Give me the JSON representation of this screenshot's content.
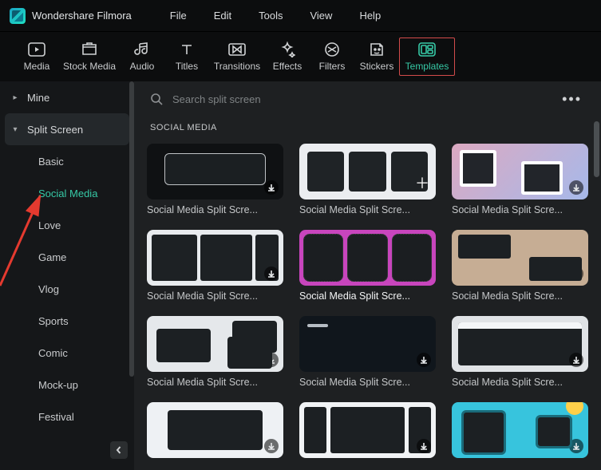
{
  "app": {
    "name": "Wondershare Filmora"
  },
  "menu": {
    "items": [
      "File",
      "Edit",
      "Tools",
      "View",
      "Help"
    ]
  },
  "toolbar": {
    "items": [
      {
        "id": "media",
        "label": "Media"
      },
      {
        "id": "stock",
        "label": "Stock Media"
      },
      {
        "id": "audio",
        "label": "Audio"
      },
      {
        "id": "titles",
        "label": "Titles"
      },
      {
        "id": "transitions",
        "label": "Transitions"
      },
      {
        "id": "effects",
        "label": "Effects"
      },
      {
        "id": "filters",
        "label": "Filters"
      },
      {
        "id": "stickers",
        "label": "Stickers"
      },
      {
        "id": "templates",
        "label": "Templates"
      }
    ],
    "active": "templates"
  },
  "sidebar": {
    "categories": [
      {
        "id": "mine",
        "label": "Mine",
        "expanded": false
      },
      {
        "id": "split",
        "label": "Split Screen",
        "expanded": true,
        "selected": true
      }
    ],
    "subcategories": [
      {
        "id": "basic",
        "label": "Basic"
      },
      {
        "id": "social",
        "label": "Social Media",
        "active": true
      },
      {
        "id": "love",
        "label": "Love"
      },
      {
        "id": "game",
        "label": "Game"
      },
      {
        "id": "vlog",
        "label": "Vlog"
      },
      {
        "id": "sports",
        "label": "Sports"
      },
      {
        "id": "comic",
        "label": "Comic"
      },
      {
        "id": "mockup",
        "label": "Mock-up"
      },
      {
        "id": "festival",
        "label": "Festival"
      }
    ]
  },
  "search": {
    "placeholder": "Search split screen"
  },
  "section": {
    "title": "SOCIAL MEDIA"
  },
  "grid": {
    "items": [
      {
        "label": "Social Media Split Scre...",
        "badge": "download"
      },
      {
        "label": "Social Media Split Scre...",
        "badge": "plus"
      },
      {
        "label": "Social Media Split Scre...",
        "badge": "download"
      },
      {
        "label": "Social Media Split Scre...",
        "badge": "download"
      },
      {
        "label": "Social Media Split Scre...",
        "bold": true,
        "badge": "none"
      },
      {
        "label": "Social Media Split Scre...",
        "badge": "download"
      },
      {
        "label": "Social Media Split Scre...",
        "badge": "download"
      },
      {
        "label": "Social Media Split Scre...",
        "badge": "download"
      },
      {
        "label": "Social Media Split Scre...",
        "badge": "download"
      },
      {
        "label": "",
        "badge": "download"
      },
      {
        "label": "",
        "badge": "download"
      },
      {
        "label": "",
        "badge": "download"
      }
    ]
  }
}
